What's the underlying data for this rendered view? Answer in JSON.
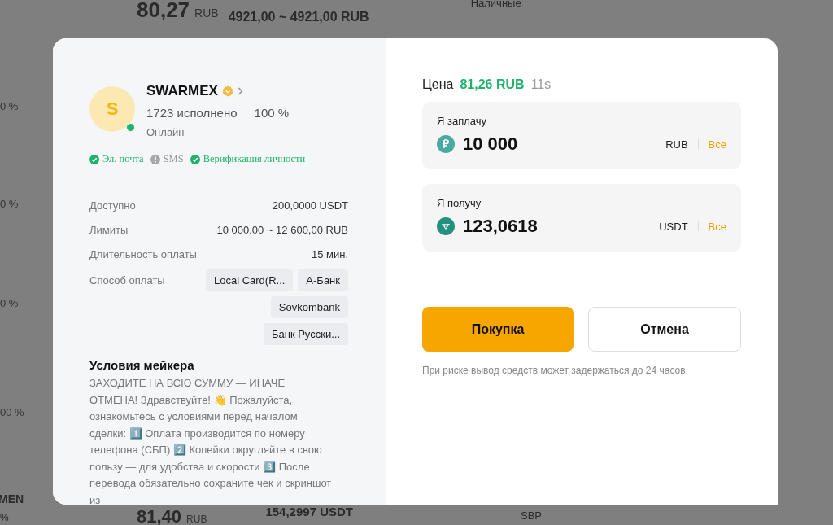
{
  "background": {
    "top": {
      "price": "80,27",
      "price_currency": "RUB",
      "limit": "4921,00 ~ 4921,00 RUB",
      "payment": "Наличные"
    },
    "side_rates": [
      "0 %",
      "0 %",
      "0 %",
      "00 %"
    ],
    "bottom": {
      "name": "MEN",
      "rate": "%",
      "price": "81,40",
      "price_currency": "RUB",
      "amount": "154,2997 USDT",
      "payment": "SBP"
    }
  },
  "merchant": {
    "avatar_letter": "S",
    "online": true,
    "name": "SWARMEX",
    "completed": "1723 исполнено",
    "rate": "100 %",
    "status": "Онлайн",
    "verifications": [
      {
        "label": "Эл. почта",
        "kind": "verified"
      },
      {
        "label": "SMS",
        "kind": "pending"
      },
      {
        "label": "Верификация личности",
        "kind": "verified"
      }
    ]
  },
  "details": [
    {
      "label": "Доступно",
      "value": "200,0000 USDT"
    },
    {
      "label": "Лимиты",
      "value": "10 000,00 ~ 12 600,00 RUB"
    },
    {
      "label": "Длительность оплаты",
      "value": "15 мин."
    }
  ],
  "payment_methods": {
    "label": "Способ оплаты",
    "items": [
      "Local Card(R...",
      "А-Банк",
      "Sovkombank",
      "Банк Русски..."
    ]
  },
  "terms": {
    "title": "Условия мейкера",
    "text": "ЗАХОДИТЕ НА ВСЮ СУММУ — ИНАЧЕ ОТМЕНА! Здравствуйте! 👋 Пожалуйста, ознакомьтесь с условиями перед началом сделки: 1️⃣ Оплата производится по номеру телефона (СБП) 2️⃣ Копейки округляйте в свою пользу — для удобства и скорости 3️⃣ После перевода обязательно сохраните чек и скриншот из"
  },
  "price": {
    "label": "Цена",
    "value": "81,26 RUB",
    "timer": "11s"
  },
  "fields": [
    {
      "label": "Я заплачу",
      "kind": "rub",
      "value": "10 000",
      "currency": "RUB",
      "max": "Все"
    },
    {
      "label": "Я получу",
      "kind": "usdt",
      "value": "123,0618",
      "currency": "USDT",
      "max": "Все"
    }
  ],
  "buttons": {
    "primary": "Покупка",
    "secondary": "Отмена"
  },
  "note": "При риске вывод средств может задержаться до 24 часов."
}
